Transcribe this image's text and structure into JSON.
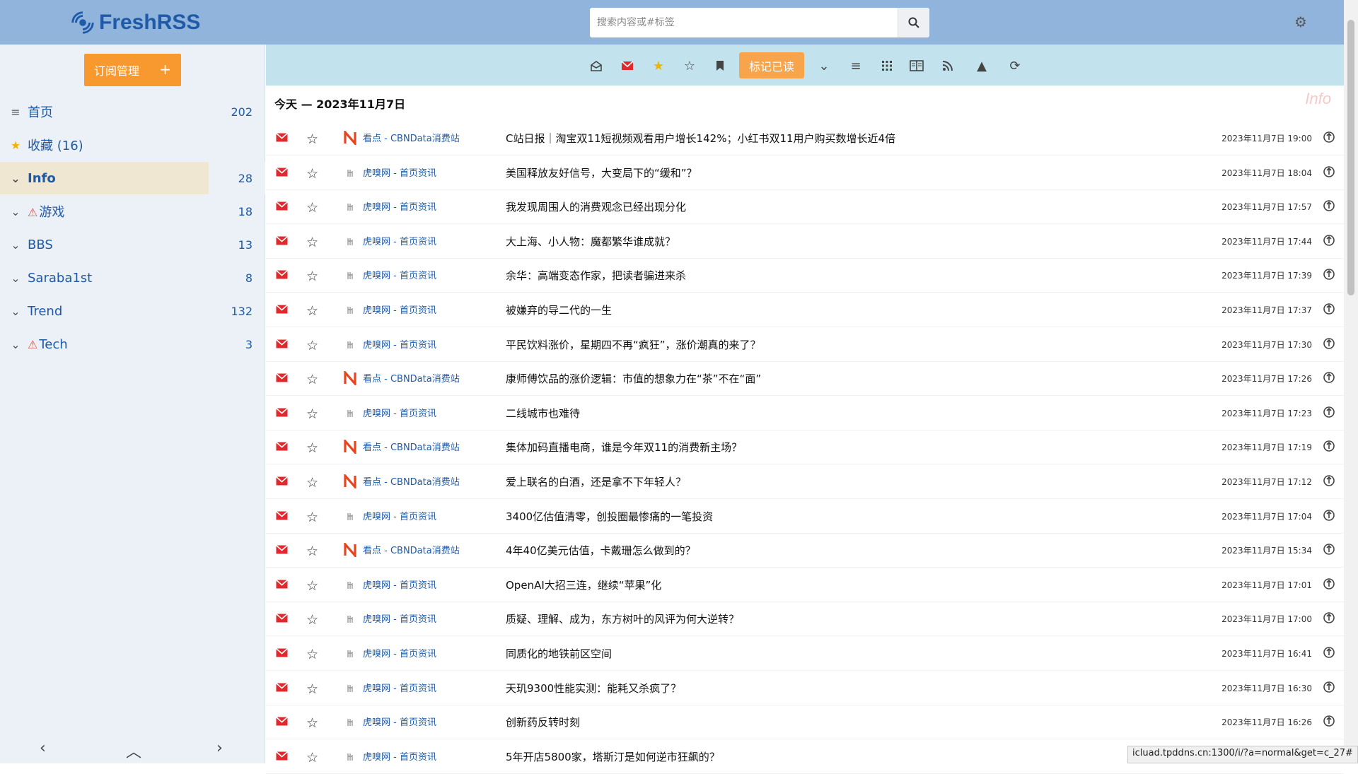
{
  "app": {
    "name": "FreshRSS"
  },
  "search": {
    "placeholder": "搜索内容或#标签"
  },
  "sidebar": {
    "manage_label": "订阅管理",
    "manage_plus": "+",
    "categories": [
      {
        "label": "首页",
        "count": "202",
        "icon": "list-icon"
      },
      {
        "label": "收藏 (16)",
        "count": "",
        "icon": "star-icon"
      },
      {
        "label": "Info",
        "count": "28",
        "icon": "chevron-down-icon",
        "active": true
      },
      {
        "label": "游戏",
        "count": "18",
        "icon": "chevron-down-icon",
        "warning": true
      },
      {
        "label": "BBS",
        "count": "13",
        "icon": "chevron-down-icon"
      },
      {
        "label": "Saraba1st",
        "count": "8",
        "icon": "chevron-down-icon"
      },
      {
        "label": "Trend",
        "count": "132",
        "icon": "chevron-down-icon"
      },
      {
        "label": "Tech",
        "count": "3",
        "icon": "chevron-down-icon",
        "warning": true
      }
    ],
    "nav": {
      "prev": "‹",
      "up": "︿",
      "next": "›"
    }
  },
  "toolbar": {
    "mark_read_label": "标记已读"
  },
  "main": {
    "day_title": "今天 — 2023年11月7日",
    "watermark": "Info",
    "articles": [
      {
        "source": "cbn",
        "feed": "看点 - CBNData消费站",
        "title": "C站日报｜淘宝双11短视频观看用户增长142%；小红书双11用户购买数增长近4倍",
        "date": "2023年11月7日 19:00"
      },
      {
        "source": "huxiu",
        "feed": "虎嗅网 - 首页资讯",
        "title": "美国释放友好信号，大变局下的“缓和”？",
        "date": "2023年11月7日 18:04"
      },
      {
        "source": "huxiu",
        "feed": "虎嗅网 - 首页资讯",
        "title": "我发现周围人的消费观念已经出现分化",
        "date": "2023年11月7日 17:57"
      },
      {
        "source": "huxiu",
        "feed": "虎嗅网 - 首页资讯",
        "title": "大上海、小人物：魔都繁华谁成就？",
        "date": "2023年11月7日 17:44"
      },
      {
        "source": "huxiu",
        "feed": "虎嗅网 - 首页资讯",
        "title": "余华：高端变态作家，把读者骗进来杀",
        "date": "2023年11月7日 17:39"
      },
      {
        "source": "huxiu",
        "feed": "虎嗅网 - 首页资讯",
        "title": "被嫌弃的导二代的一生",
        "date": "2023年11月7日 17:37"
      },
      {
        "source": "huxiu",
        "feed": "虎嗅网 - 首页资讯",
        "title": "平民饮料涨价，星期四不再“疯狂”，涨价潮真的来了？",
        "date": "2023年11月7日 17:30"
      },
      {
        "source": "cbn",
        "feed": "看点 - CBNData消费站",
        "title": "康师傅饮品的涨价逻辑：市值的想象力在“茶”不在“面”",
        "date": "2023年11月7日 17:26"
      },
      {
        "source": "huxiu",
        "feed": "虎嗅网 - 首页资讯",
        "title": "二线城市也难待",
        "date": "2023年11月7日 17:23"
      },
      {
        "source": "cbn",
        "feed": "看点 - CBNData消费站",
        "title": "集体加码直播电商，谁是今年双11的消费新主场？",
        "date": "2023年11月7日 17:19"
      },
      {
        "source": "cbn",
        "feed": "看点 - CBNData消费站",
        "title": "爱上联名的白酒，还是拿不下年轻人？",
        "date": "2023年11月7日 17:12"
      },
      {
        "source": "huxiu",
        "feed": "虎嗅网 - 首页资讯",
        "title": "3400亿估值清零，创投圈最惨痛的一笔投资",
        "date": "2023年11月7日 17:04"
      },
      {
        "source": "cbn",
        "feed": "看点 - CBNData消费站",
        "title": "4年40亿美元估值，卡戴珊怎么做到的？",
        "date": "2023年11月7日 15:34"
      },
      {
        "source": "huxiu",
        "feed": "虎嗅网 - 首页资讯",
        "title": "OpenAI大招三连，继续“苹果”化",
        "date": "2023年11月7日 17:01"
      },
      {
        "source": "huxiu",
        "feed": "虎嗅网 - 首页资讯",
        "title": "质疑、理解、成为，东方树叶的风评为何大逆转？",
        "date": "2023年11月7日 17:00"
      },
      {
        "source": "huxiu",
        "feed": "虎嗅网 - 首页资讯",
        "title": "同质化的地铁前区空间",
        "date": "2023年11月7日 16:41"
      },
      {
        "source": "huxiu",
        "feed": "虎嗅网 - 首页资讯",
        "title": "天玑9300性能实测：能耗又杀疯了？",
        "date": "2023年11月7日 16:30"
      },
      {
        "source": "huxiu",
        "feed": "虎嗅网 - 首页资讯",
        "title": "创新药反转时刻",
        "date": "2023年11月7日 16:26"
      },
      {
        "source": "huxiu",
        "feed": "虎嗅网 - 首页资讯",
        "title": "5年开店5800家，塔斯汀是如何逆市狂飙的？",
        "date": ""
      }
    ]
  },
  "status_url": "icluad.tpddns.cn:1300/i/?a=normal&get=c_27#",
  "colors": {
    "header": "#90b4dc",
    "toolbar": "#c2e3ee",
    "accent": "#f7992f",
    "link": "#1e5aa8",
    "mail": "#e0282d"
  }
}
